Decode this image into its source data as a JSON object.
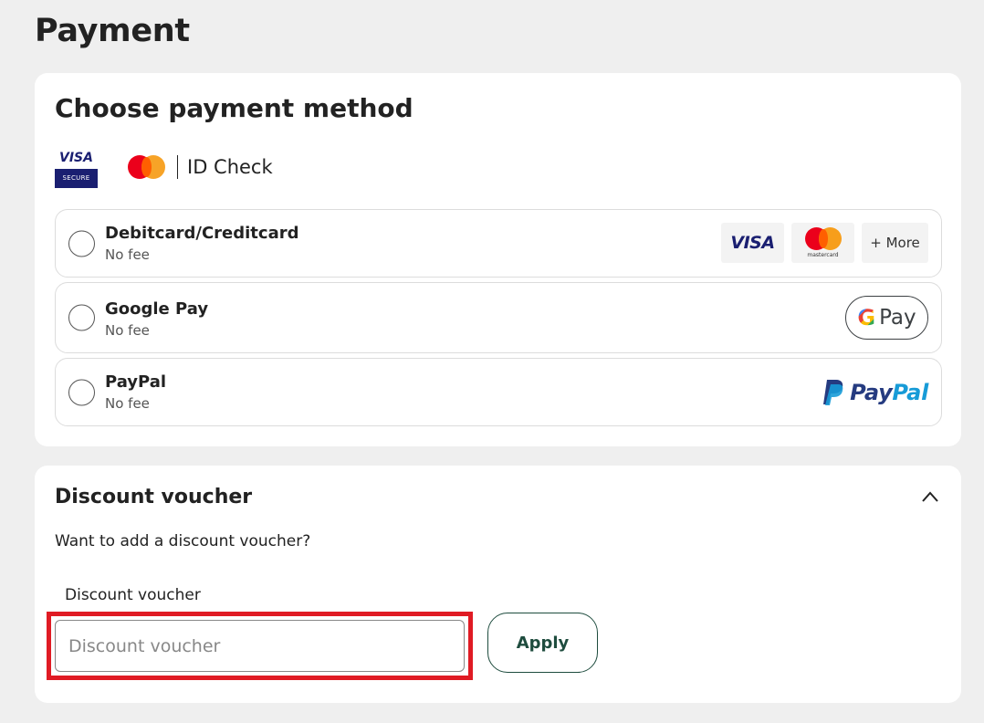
{
  "page": {
    "title": "Payment"
  },
  "payment": {
    "title": "Choose payment method",
    "secure_badges": {
      "visa_top": "VISA",
      "visa_bottom": "SECURE",
      "id_check": "ID Check"
    },
    "methods": [
      {
        "name": "Debitcard/Creditcard",
        "fee": "No fee",
        "logos": [
          "VISA",
          "mastercard",
          "+ More"
        ]
      },
      {
        "name": "Google Pay",
        "fee": "No fee",
        "logo_text": "Pay"
      },
      {
        "name": "PayPal",
        "fee": "No fee",
        "logo_text_1": "Pay",
        "logo_text_2": "Pal"
      }
    ]
  },
  "voucher": {
    "title": "Discount voucher",
    "question": "Want to add a discount voucher?",
    "field_label": "Discount voucher",
    "input_placeholder": "Discount voucher",
    "input_value": "",
    "apply_label": "Apply"
  },
  "colors": {
    "visa_blue": "#1a1f71",
    "mc_red": "#eb001b",
    "mc_orange": "#f79e1b",
    "highlight_red": "#e01b24",
    "apply_green": "#1e4c3e",
    "paypal_dark": "#253b80",
    "paypal_light": "#179bd7"
  }
}
